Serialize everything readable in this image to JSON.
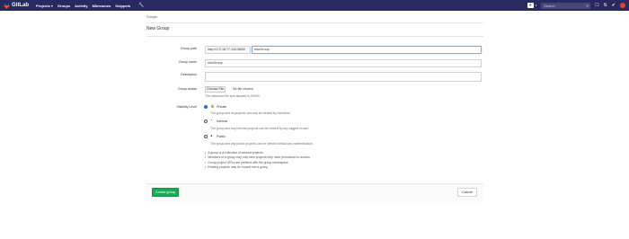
{
  "navbar": {
    "brand": "GitLab",
    "links": [
      "Projects",
      "Groups",
      "Activity",
      "Milestones",
      "Snippets"
    ],
    "search_placeholder": "Search",
    "colors": {
      "navbar": "#292961",
      "logo": "#e24329"
    }
  },
  "breadcrumb": "Groups",
  "page_title": "New Group",
  "form": {
    "group_path_label": "Group path",
    "group_path_prefix": "http://172.18.77.143:3800/",
    "group_path_value": "newGroup",
    "group_name_label": "Group name",
    "group_name_value": "newGroup",
    "description_label": "Description",
    "avatar_label": "Group avatar",
    "choose_file_label": "Choose File",
    "no_file_label": "No file chosen",
    "avatar_help": "The maximum file size allowed is 200KB.",
    "visibility_label": "Visibility Level",
    "visibility_options": [
      {
        "title": "Private",
        "description": "The group and its projects can only be viewed by members.",
        "selected": true,
        "icon": "lock-icon"
      },
      {
        "title": "Internal",
        "description": "The group and any internal projects can be viewed by any logged in user.",
        "selected": false,
        "icon": "shield-icon"
      },
      {
        "title": "Public",
        "description": "The group and any public projects can be viewed without any authentication.",
        "selected": false,
        "icon": "globe-icon"
      }
    ],
    "notes": [
      "A group is a collection of several projects",
      "Members of a group may only view projects they have permission to access",
      "Group project URLs are prefixed with the group namespace",
      "Existing projects may be moved into a group"
    ],
    "create_label": "Create group",
    "cancel_label": "Cancel"
  }
}
